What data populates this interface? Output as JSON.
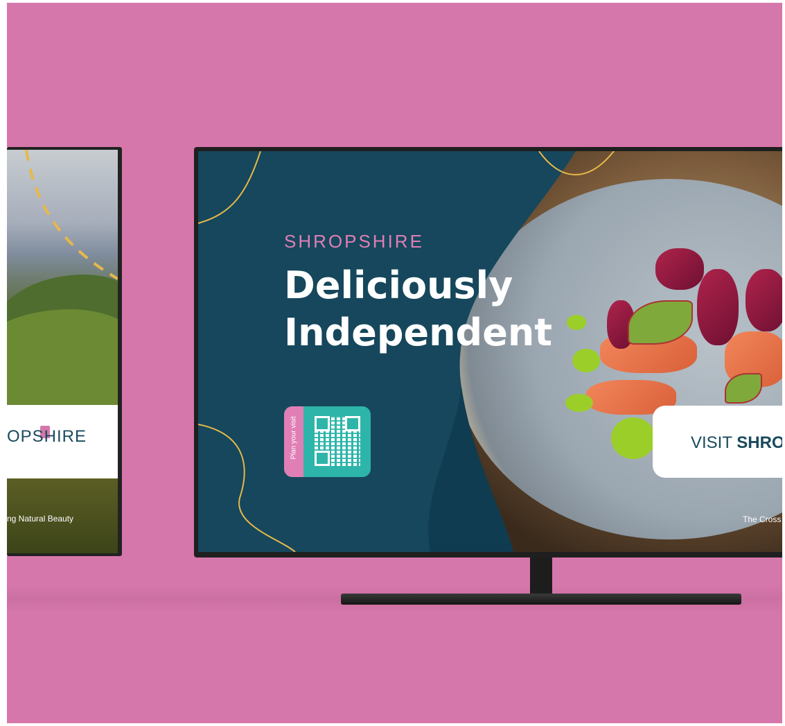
{
  "left_tv": {
    "brand": "OPSHIRE",
    "caption": "ng Natural Beauty"
  },
  "right_tv": {
    "kicker": "SHROPSHIRE",
    "headline_line1": "Deliciously",
    "headline_line2": "Independent",
    "qr_label": "Plan your visit",
    "visit_prefix": "VISIT ",
    "visit_brand": "SHRO",
    "credit": "The Cross"
  },
  "colors": {
    "background": "#d677ab",
    "navy": "#16475c",
    "pink": "#e07fb6",
    "teal": "#2eb5a9",
    "yellow": "#e7b84a"
  }
}
